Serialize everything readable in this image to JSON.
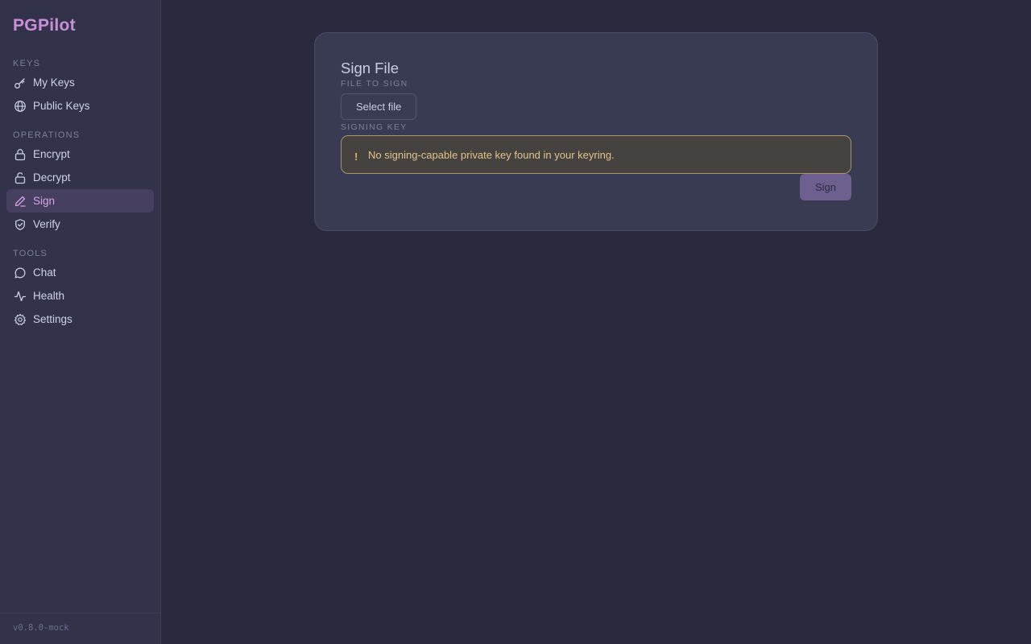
{
  "app": {
    "title": "PGPilot",
    "version": "v0.8.0-mock"
  },
  "sidebar": {
    "sections": [
      {
        "label": "KEYS",
        "items": [
          {
            "label": "My Keys",
            "icon": "key-icon"
          },
          {
            "label": "Public Keys",
            "icon": "globe-icon"
          }
        ]
      },
      {
        "label": "OPERATIONS",
        "items": [
          {
            "label": "Encrypt",
            "icon": "lock-icon"
          },
          {
            "label": "Decrypt",
            "icon": "unlock-icon"
          },
          {
            "label": "Sign",
            "icon": "pen-icon",
            "active": true
          },
          {
            "label": "Verify",
            "icon": "shield-check-icon"
          }
        ]
      },
      {
        "label": "TOOLS",
        "items": [
          {
            "label": "Chat",
            "icon": "chat-bubble-icon"
          },
          {
            "label": "Health",
            "icon": "activity-icon"
          },
          {
            "label": "Settings",
            "icon": "gear-icon"
          }
        ]
      }
    ]
  },
  "main": {
    "title": "Sign File",
    "file_label": "FILE TO SIGN",
    "select_file_label": "Select file",
    "signing_key_label": "SIGNING KEY",
    "warning_icon": "!",
    "warning_text": "No signing-capable private key found in your keyring.",
    "sign_button_label": "Sign",
    "sign_button_disabled": true
  },
  "colors": {
    "accent": "#c98fd9",
    "background": "#292a3d",
    "sidebar": "#32334a",
    "card": "#393b52",
    "warning_border": "#a89365",
    "warning_text": "#e2c48c"
  }
}
